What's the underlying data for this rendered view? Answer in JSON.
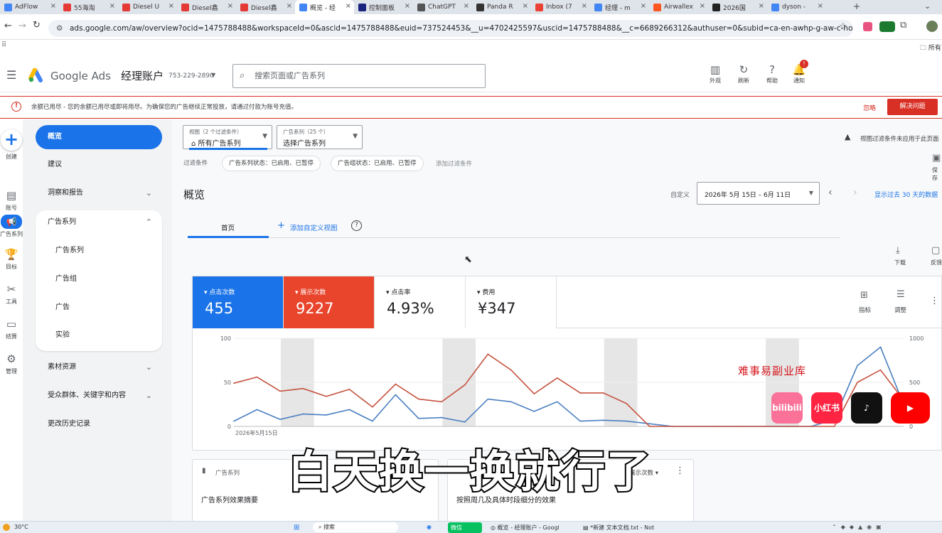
{
  "browser": {
    "tabs": [
      {
        "label": "AdFlow",
        "color": "#4285f4"
      },
      {
        "label": "55海淘",
        "color": "#e53935"
      },
      {
        "label": "Diesel U",
        "color": "#e53935"
      },
      {
        "label": "Diesel鑫",
        "color": "#e53935"
      },
      {
        "label": "Diesel鑫",
        "color": "#e53935"
      },
      {
        "label": "概览 - 经",
        "color": "#4285f4"
      },
      {
        "label": "控制面板",
        "color": "#1a237e"
      },
      {
        "label": "ChatGPT",
        "color": "#555555"
      },
      {
        "label": "Panda R",
        "color": "#333333"
      },
      {
        "label": "Inbox (7",
        "color": "#ea4335"
      },
      {
        "label": "经理 - m",
        "color": "#4285f4"
      },
      {
        "label": "Airwallex",
        "color": "#ff5722"
      },
      {
        "label": "2026国",
        "color": "#222222"
      },
      {
        "label": "dyson -",
        "color": "#4285f4"
      }
    ],
    "url": "ads.google.com/aw/overview?ocid=1475788488&workspaceId=0&ascid=1475788488&euid=737524453&__u=4702425597&uscid=1475788488&__c=6689266312&authuser=0&subid=ca-en-awhp-g-aw-c-home-top%21o2...",
    "bookmarks_label": "所有"
  },
  "header": {
    "product": "Google Ads",
    "account_type": "经理账户",
    "account_id": "753-229-2890",
    "search_placeholder": "搜索页面或广告系列",
    "icons": [
      {
        "name": "appearance",
        "label": "外观",
        "glyph": "▥"
      },
      {
        "name": "refresh",
        "label": "刷新",
        "glyph": "↻"
      },
      {
        "name": "help",
        "label": "帮助",
        "glyph": "?"
      },
      {
        "name": "notifications",
        "label": "通知",
        "glyph": "🔔"
      }
    ],
    "notification_count": "!"
  },
  "alert": {
    "text": "余额已用尽 - 您的余额已用尽或即将用尽。为确保您的广告继续正常投放，请通过付款为账号充值。",
    "dismiss": "忽略",
    "fix": "解决问题"
  },
  "rail": [
    {
      "name": "create",
      "label": "创建",
      "glyph": "+"
    },
    {
      "name": "account",
      "label": "账号",
      "glyph": "▤"
    },
    {
      "name": "campaigns",
      "label": "广告系列",
      "glyph": "📢"
    },
    {
      "name": "goals",
      "label": "目标",
      "glyph": "🏆"
    },
    {
      "name": "tools",
      "label": "工具",
      "glyph": "✂"
    },
    {
      "name": "billing",
      "label": "结算",
      "glyph": "▭"
    },
    {
      "name": "admin",
      "label": "管理",
      "glyph": "⚙"
    }
  ],
  "nav": {
    "overview": "概览",
    "recommendations": "建议",
    "insights": "洞察和报告",
    "campaigns": "广告系列",
    "sub": [
      "广告系列",
      "广告组",
      "广告",
      "实验"
    ],
    "assets": "素材资源",
    "audiences": "受众群体、关键字和内容",
    "history": "更改历史记录"
  },
  "filters": {
    "view_label": "视图（2 个过滤条件）",
    "view_value": "所有广告系列",
    "campaign_label": "广告系列（25 个）",
    "campaign_value": "选择广告系列",
    "filter_label": "过滤条件",
    "chips": [
      "广告系列状态：已启用、已暂停",
      "广告组状态：已启用、已暂停"
    ],
    "add_filter": "添加过滤条件",
    "notice": "视图过滤条件未应用于此页面",
    "save": "保存"
  },
  "page": {
    "title": "概览",
    "custom": "自定义",
    "date_range": "2026年 5月 15日 – 6月 11日",
    "compare_link": "显示过去 30 天的数据",
    "tab_home": "首页",
    "add_view": "添加自定义视图",
    "download": "下载",
    "feedback": "反馈"
  },
  "scorecards": [
    {
      "metric": "点击次数",
      "value": "455",
      "color": "#1a73e8"
    },
    {
      "metric": "展示次数",
      "value": "9227",
      "color": "#e8452c"
    },
    {
      "metric": "点击率",
      "value": "4.93%",
      "color": "#ffffff"
    },
    {
      "metric": "费用",
      "value": "¥347",
      "color": "#ffffff"
    }
  ],
  "card_actions": {
    "metrics": "指标",
    "adjust": "调整"
  },
  "chart_data": {
    "type": "line",
    "x_start_label": "2026年5月15日",
    "left_axis_ticks": [
      "100",
      "50",
      "0"
    ],
    "right_axis_ticks": [
      "1000",
      "500",
      "0"
    ],
    "y_left_range": [
      0,
      100
    ],
    "y_right_range": [
      0,
      1000
    ],
    "series": [
      {
        "name": "点击次数",
        "axis": "left",
        "color": "#4a7fc1",
        "values": [
          6,
          19,
          8,
          14,
          13,
          19,
          6,
          36,
          9,
          10,
          5,
          31,
          28,
          17,
          28,
          6,
          7,
          6,
          3,
          0,
          0,
          0,
          0,
          0,
          0,
          0,
          8,
          69,
          90,
          25
        ]
      },
      {
        "name": "展示次数",
        "axis": "right",
        "color": "#c5523f",
        "values": [
          490,
          560,
          400,
          430,
          340,
          420,
          220,
          480,
          310,
          280,
          470,
          820,
          640,
          370,
          550,
          380,
          380,
          260,
          0,
          0,
          0,
          0,
          0,
          0,
          0,
          0,
          0,
          500,
          640,
          300
        ]
      }
    ],
    "weekend_bands": [
      [
        2,
        3
      ],
      [
        9,
        10
      ],
      [
        16,
        17
      ],
      [
        23,
        24
      ]
    ]
  },
  "bottom_cards": {
    "campaigns_title": "广告系列",
    "campaigns_summary": "广告系列效果摘要",
    "second_metric": "展示次数",
    "second_title": "按照周几及具体时段细分的效果"
  },
  "watermark": "难事易副业库",
  "social_badges": [
    {
      "name": "bilibili",
      "label": "bilibili",
      "color": "#fb7299"
    },
    {
      "name": "xiaohongshu",
      "label": "小红书",
      "color": "#ff2442"
    },
    {
      "name": "tiktok",
      "label": "♪",
      "color": "#111111"
    },
    {
      "name": "youtube",
      "label": "▶",
      "color": "#ff0000"
    }
  ],
  "subtitle": "白天换一换就行了",
  "taskbar": {
    "weather": "30°C",
    "search": "搜索",
    "wechat": "微信",
    "app1": "概览 - 经理账户 - Googl",
    "app2": "*新建 文本文档.txt - Not"
  }
}
